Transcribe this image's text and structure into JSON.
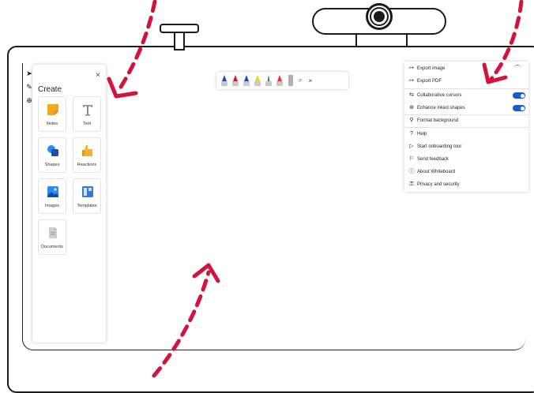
{
  "panel": {
    "title": "Create",
    "close_glyph": "×",
    "tiles": [
      {
        "label": "Notes",
        "icon": "sticky-note-icon",
        "color": "#f5a623"
      },
      {
        "label": "Text",
        "icon": "text-icon",
        "color": "#8a8a8a"
      },
      {
        "label": "Shapes",
        "icon": "shapes-icon",
        "color": "#1c6fe0"
      },
      {
        "label": "Reactions",
        "icon": "thumbs-up-icon",
        "color": "#f0b030"
      },
      {
        "label": "Images",
        "icon": "image-icon",
        "color": "#1c6fe0"
      },
      {
        "label": "Templates",
        "icon": "templates-icon",
        "color": "#3a78d6"
      },
      {
        "label": "Documents",
        "icon": "document-icon",
        "color": "#9a9a9a"
      }
    ]
  },
  "toolbar": {
    "pens": [
      {
        "color": "#1e4fa8"
      },
      {
        "color": "#d21b1b"
      },
      {
        "color": "#1e4fa8"
      },
      {
        "color": "#f2d31b"
      },
      {
        "color": "#1e8a3a"
      },
      {
        "color": "#e0383a"
      },
      {
        "color": "#b0b0b0"
      }
    ],
    "lasso_glyph": "⌕",
    "close_glyph": "×"
  },
  "menu": {
    "items": [
      {
        "icon": "↦",
        "label": "Export image"
      },
      {
        "icon": "↦",
        "label": "Export PDF"
      },
      {
        "icon": "⇆",
        "label": "Collaborative cursors",
        "toggle": true
      },
      {
        "icon": "⊛",
        "label": "Enhance inked shapes",
        "toggle": true
      },
      {
        "icon": "⚲",
        "label": "Format background"
      },
      {
        "icon": "?",
        "label": "Help"
      },
      {
        "icon": "▷",
        "label": "Start onboarding tour"
      },
      {
        "icon": "⚐",
        "label": "Send feedback"
      },
      {
        "icon": "ⓘ",
        "label": "About Whiteboard"
      },
      {
        "icon": "⚿",
        "label": "Privacy and security"
      }
    ]
  },
  "colors": {
    "annotation_arrow": "#d2133c",
    "toggle_on": "#1a5cd8"
  }
}
